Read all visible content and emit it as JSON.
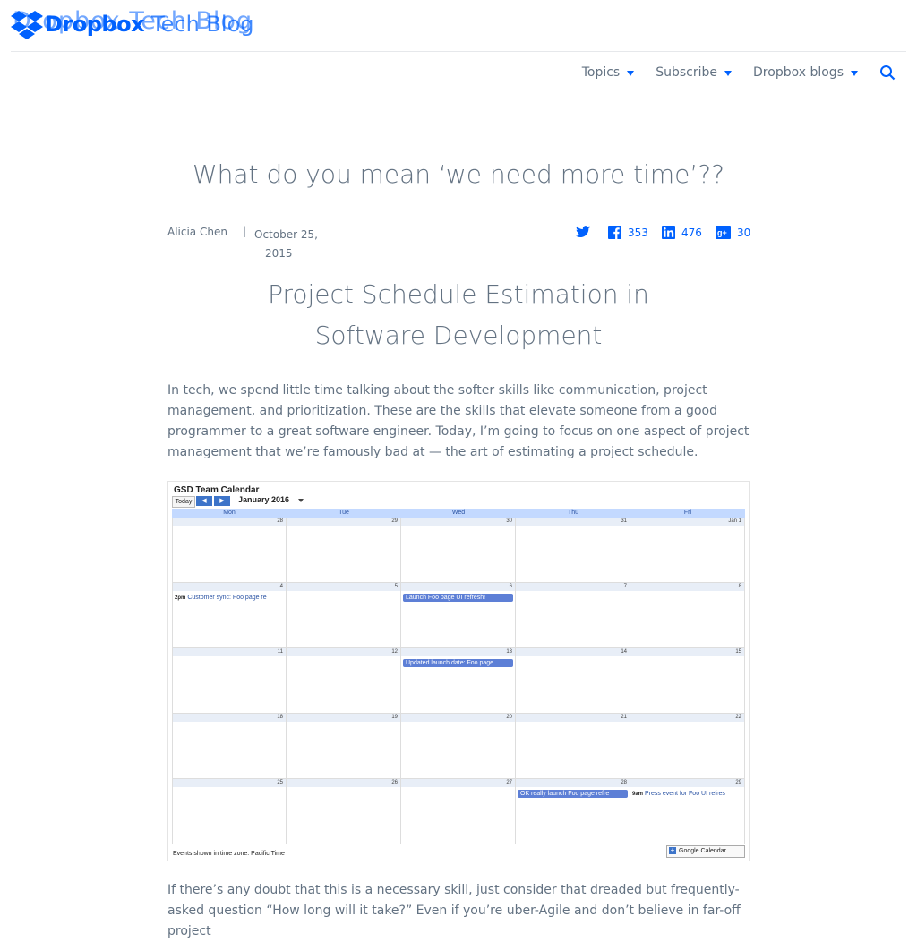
{
  "header": {
    "logo_text": "Dropbox",
    "logo_ghost": "Dropbox Tech Blog",
    "blog_name": "Tech Blog",
    "nav": [
      {
        "label": "Topics"
      },
      {
        "label": "Subscribe"
      },
      {
        "label": "Dropbox blogs"
      }
    ]
  },
  "article": {
    "title": "What do you mean ‘we need more time’??",
    "author": "Alicia Chen",
    "date_line1": "October 25,",
    "date_line2": "2015",
    "share": {
      "facebook": "353",
      "linkedin": "476",
      "gplus": "30"
    },
    "subtitle": "Project Schedule Estimation in Software Development",
    "intro": "In tech, we spend little time talking about the softer skills like communication, project management, and prioritization. These are the skills that elevate someone from a good programmer to a great software engineer. Today, I’m going to focus on one aspect of project management that we’re famously bad at — the art of estimating a project schedule.",
    "para2": "If there’s any doubt that this is a necessary skill, just consider that dreaded but frequently-asked question “How long will it take?” Even if you’re uber-Agile and don’t believe in far-off project"
  },
  "calendar": {
    "title": "GSD Team Calendar",
    "today": "Today",
    "prev": "◀",
    "next": "▶",
    "month": "January 2016",
    "days": [
      "Mon",
      "Tue",
      "Wed",
      "Thu",
      "Fri"
    ],
    "weeks": [
      [
        {
          "d": "28"
        },
        {
          "d": "29"
        },
        {
          "d": "30"
        },
        {
          "d": "31"
        },
        {
          "d": "Jan 1"
        }
      ],
      [
        {
          "d": "4",
          "ev": "Customer sync: Foo page re",
          "time": "2pm"
        },
        {
          "d": "5"
        },
        {
          "d": "6",
          "ev": "Launch Foo page UI refresh!",
          "fill": true
        },
        {
          "d": "7"
        },
        {
          "d": "8"
        }
      ],
      [
        {
          "d": "11"
        },
        {
          "d": "12"
        },
        {
          "d": "13",
          "ev": "Updated launch date: Foo page",
          "fill": true
        },
        {
          "d": "14"
        },
        {
          "d": "15"
        }
      ],
      [
        {
          "d": "18"
        },
        {
          "d": "19"
        },
        {
          "d": "20"
        },
        {
          "d": "21"
        },
        {
          "d": "22"
        }
      ],
      [
        {
          "d": "25"
        },
        {
          "d": "26"
        },
        {
          "d": "27"
        },
        {
          "d": "28",
          "ev": "OK really launch Foo page refre",
          "fill": true
        },
        {
          "d": "29",
          "ev": "Press event for Foo UI refres",
          "time": "9am"
        }
      ]
    ],
    "footer": "Events shown in time zone: Pacific Time",
    "gcal": "Google Calendar"
  },
  "colors": {
    "brand": "#0061fe",
    "text": "#637282",
    "calendar_event": "#5d7fd6",
    "calendar_header": "#c3d9ff"
  }
}
